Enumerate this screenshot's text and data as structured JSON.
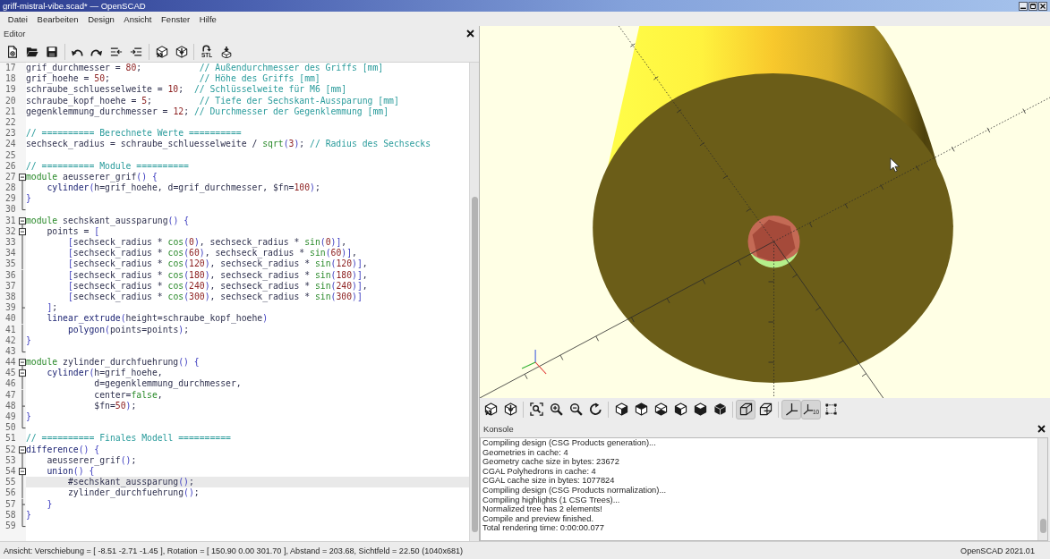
{
  "window": {
    "title": "griff-mistral-vibe.scad* — OpenSCAD"
  },
  "menu": [
    "Datei",
    "Bearbeiten",
    "Design",
    "Ansicht",
    "Fenster",
    "Hilfe"
  ],
  "editor": {
    "title": "Editor",
    "export_label": "STL",
    "lines": [
      {
        "number": "17",
        "kind": "plain",
        "selected": false,
        "tokens": [
          {
            "kind": "text",
            "text": "grif_durchmesser = "
          },
          {
            "kind": "number",
            "text": "80"
          },
          {
            "kind": "text",
            "text": ";           "
          },
          {
            "kind": "comment",
            "text": "// Außendurchmesser des Griffs [mm]"
          }
        ]
      },
      {
        "number": "18",
        "kind": "plain",
        "selected": false,
        "tokens": [
          {
            "kind": "text",
            "text": "grif_hoehe = "
          },
          {
            "kind": "number",
            "text": "50"
          },
          {
            "kind": "text",
            "text": ";                 "
          },
          {
            "kind": "comment",
            "text": "// Höhe des Griffs [mm]"
          }
        ]
      },
      {
        "number": "19",
        "kind": "plain",
        "selected": false,
        "tokens": [
          {
            "kind": "text",
            "text": "schraube_schluesselweite = "
          },
          {
            "kind": "number",
            "text": "10"
          },
          {
            "kind": "text",
            "text": ";  "
          },
          {
            "kind": "comment",
            "text": "// Schlüsselweite für M6 [mm]"
          }
        ]
      },
      {
        "number": "20",
        "kind": "plain",
        "selected": false,
        "tokens": [
          {
            "kind": "text",
            "text": "schraube_kopf_hoehe = "
          },
          {
            "kind": "number",
            "text": "5"
          },
          {
            "kind": "text",
            "text": ";         "
          },
          {
            "kind": "comment",
            "text": "// Tiefe der Sechskant-Aussparung [mm]"
          }
        ]
      },
      {
        "number": "21",
        "kind": "plain",
        "selected": false,
        "tokens": [
          {
            "kind": "text",
            "text": "gegenklemmung_durchmesser = "
          },
          {
            "kind": "number",
            "text": "12"
          },
          {
            "kind": "text",
            "text": "; "
          },
          {
            "kind": "comment",
            "text": "// Durchmesser der Gegenklemmung [mm]"
          }
        ]
      },
      {
        "number": "22",
        "kind": "plain",
        "selected": false
      },
      {
        "number": "23",
        "kind": "plain",
        "selected": false,
        "tokens": [
          {
            "kind": "comment",
            "text": "// ========== Berechnete Werte =========="
          }
        ]
      },
      {
        "number": "24",
        "kind": "plain",
        "selected": false,
        "tokens": [
          {
            "kind": "text",
            "text": "sechseck_radius = schraube_schluesselweite / "
          },
          {
            "kind": "keyword",
            "text": "sqrt"
          },
          {
            "kind": "bracket",
            "text": "("
          },
          {
            "kind": "number",
            "text": "3"
          },
          {
            "kind": "bracket",
            "text": ")"
          },
          {
            "kind": "text",
            "text": "; "
          },
          {
            "kind": "comment",
            "text": "// Radius des Sechsecks"
          }
        ]
      },
      {
        "number": "25",
        "kind": "plain",
        "selected": false
      },
      {
        "number": "26",
        "kind": "plain",
        "selected": false,
        "tokens": [
          {
            "kind": "comment",
            "text": "// ========== Module =========="
          }
        ]
      },
      {
        "number": "27",
        "kind": "start",
        "expanded": true,
        "selected": false,
        "tokens": [
          {
            "kind": "keyword",
            "text": "module"
          },
          {
            "kind": "text",
            "text": " aeusserer_grif"
          },
          {
            "kind": "bracket",
            "text": "() {"
          }
        ]
      },
      {
        "number": "28",
        "kind": "body",
        "selected": false,
        "tokens": [
          {
            "kind": "builtin",
            "text": "    cylinder"
          },
          {
            "kind": "bracket",
            "text": "("
          },
          {
            "kind": "text",
            "text": "h=grif_hoehe, d=grif_durchmesser, $fn="
          },
          {
            "kind": "number",
            "text": "100"
          },
          {
            "kind": "bracket",
            "text": ")"
          },
          {
            "kind": "text",
            "text": ";"
          }
        ]
      },
      {
        "number": "29",
        "kind": "body",
        "selected": false,
        "tokens": [
          {
            "kind": "bracket",
            "text": "}"
          }
        ]
      },
      {
        "number": "30",
        "kind": "end",
        "selected": false
      },
      {
        "number": "31",
        "kind": "start",
        "expanded": true,
        "selected": false,
        "tokens": [
          {
            "kind": "keyword",
            "text": "module"
          },
          {
            "kind": "text",
            "text": " sechskant_aussparung"
          },
          {
            "kind": "bracket",
            "text": "() {"
          }
        ]
      },
      {
        "number": "32",
        "kind": "start",
        "expanded": true,
        "selected": false,
        "tokens": [
          {
            "kind": "text",
            "text": "    points = "
          },
          {
            "kind": "bracket",
            "text": "["
          }
        ]
      },
      {
        "number": "33",
        "kind": "body",
        "selected": false,
        "tokens": [
          {
            "kind": "bracket",
            "text": "        ["
          },
          {
            "kind": "text",
            "text": "sechseck_radius * "
          },
          {
            "kind": "keyword",
            "text": "cos"
          },
          {
            "kind": "bracket",
            "text": "("
          },
          {
            "kind": "number",
            "text": "0"
          },
          {
            "kind": "bracket",
            "text": ")"
          },
          {
            "kind": "text",
            "text": ", sechseck_radius * "
          },
          {
            "kind": "keyword",
            "text": "sin"
          },
          {
            "kind": "bracket",
            "text": "("
          },
          {
            "kind": "number",
            "text": "0"
          },
          {
            "kind": "bracket",
            "text": ")]"
          },
          {
            "kind": "text",
            "text": ","
          }
        ]
      },
      {
        "number": "34",
        "kind": "body",
        "selected": false,
        "tokens": [
          {
            "kind": "bracket",
            "text": "        ["
          },
          {
            "kind": "text",
            "text": "sechseck_radius * "
          },
          {
            "kind": "keyword",
            "text": "cos"
          },
          {
            "kind": "bracket",
            "text": "("
          },
          {
            "kind": "number",
            "text": "60"
          },
          {
            "kind": "bracket",
            "text": ")"
          },
          {
            "kind": "text",
            "text": ", sechseck_radius * "
          },
          {
            "kind": "keyword",
            "text": "sin"
          },
          {
            "kind": "bracket",
            "text": "("
          },
          {
            "kind": "number",
            "text": "60"
          },
          {
            "kind": "bracket",
            "text": ")]"
          },
          {
            "kind": "text",
            "text": ","
          }
        ]
      },
      {
        "number": "35",
        "kind": "body",
        "selected": false,
        "tokens": [
          {
            "kind": "bracket",
            "text": "        ["
          },
          {
            "kind": "text",
            "text": "sechseck_radius * "
          },
          {
            "kind": "keyword",
            "text": "cos"
          },
          {
            "kind": "bracket",
            "text": "("
          },
          {
            "kind": "number",
            "text": "120"
          },
          {
            "kind": "bracket",
            "text": ")"
          },
          {
            "kind": "text",
            "text": ", sechseck_radius * "
          },
          {
            "kind": "keyword",
            "text": "sin"
          },
          {
            "kind": "bracket",
            "text": "("
          },
          {
            "kind": "number",
            "text": "120"
          },
          {
            "kind": "bracket",
            "text": ")]"
          },
          {
            "kind": "text",
            "text": ","
          }
        ]
      },
      {
        "number": "36",
        "kind": "body",
        "selected": false,
        "tokens": [
          {
            "kind": "bracket",
            "text": "        ["
          },
          {
            "kind": "text",
            "text": "sechseck_radius * "
          },
          {
            "kind": "keyword",
            "text": "cos"
          },
          {
            "kind": "bracket",
            "text": "("
          },
          {
            "kind": "number",
            "text": "180"
          },
          {
            "kind": "bracket",
            "text": ")"
          },
          {
            "kind": "text",
            "text": ", sechseck_radius * "
          },
          {
            "kind": "keyword",
            "text": "sin"
          },
          {
            "kind": "bracket",
            "text": "("
          },
          {
            "kind": "number",
            "text": "180"
          },
          {
            "kind": "bracket",
            "text": ")]"
          },
          {
            "kind": "text",
            "text": ","
          }
        ]
      },
      {
        "number": "37",
        "kind": "body",
        "selected": false,
        "tokens": [
          {
            "kind": "bracket",
            "text": "        ["
          },
          {
            "kind": "text",
            "text": "sechseck_radius * "
          },
          {
            "kind": "keyword",
            "text": "cos"
          },
          {
            "kind": "bracket",
            "text": "("
          },
          {
            "kind": "number",
            "text": "240"
          },
          {
            "kind": "bracket",
            "text": ")"
          },
          {
            "kind": "text",
            "text": ", sechseck_radius * "
          },
          {
            "kind": "keyword",
            "text": "sin"
          },
          {
            "kind": "bracket",
            "text": "("
          },
          {
            "kind": "number",
            "text": "240"
          },
          {
            "kind": "bracket",
            "text": ")]"
          },
          {
            "kind": "text",
            "text": ","
          }
        ]
      },
      {
        "number": "38",
        "kind": "body",
        "selected": false,
        "tokens": [
          {
            "kind": "bracket",
            "text": "        ["
          },
          {
            "kind": "text",
            "text": "sechseck_radius * "
          },
          {
            "kind": "keyword",
            "text": "cos"
          },
          {
            "kind": "bracket",
            "text": "("
          },
          {
            "kind": "number",
            "text": "300"
          },
          {
            "kind": "bracket",
            "text": ")"
          },
          {
            "kind": "text",
            "text": ", sechseck_radius * "
          },
          {
            "kind": "keyword",
            "text": "sin"
          },
          {
            "kind": "bracket",
            "text": "("
          },
          {
            "kind": "number",
            "text": "300"
          },
          {
            "kind": "bracket",
            "text": ")]"
          }
        ]
      },
      {
        "number": "39",
        "kind": "tick",
        "selected": false,
        "tokens": [
          {
            "kind": "bracket",
            "text": "    ]"
          },
          {
            "kind": "text",
            "text": ";"
          }
        ]
      },
      {
        "number": "40",
        "kind": "body",
        "selected": false,
        "tokens": [
          {
            "kind": "builtin",
            "text": "    linear_extrude"
          },
          {
            "kind": "bracket",
            "text": "("
          },
          {
            "kind": "text",
            "text": "height=schraube_kopf_hoehe"
          },
          {
            "kind": "bracket",
            "text": ")"
          }
        ]
      },
      {
        "number": "41",
        "kind": "body",
        "selected": false,
        "tokens": [
          {
            "kind": "builtin",
            "text": "        polygon"
          },
          {
            "kind": "bracket",
            "text": "("
          },
          {
            "kind": "text",
            "text": "points=points"
          },
          {
            "kind": "bracket",
            "text": ")"
          },
          {
            "kind": "text",
            "text": ";"
          }
        ]
      },
      {
        "number": "42",
        "kind": "body",
        "selected": false,
        "tokens": [
          {
            "kind": "bracket",
            "text": "}"
          }
        ]
      },
      {
        "number": "43",
        "kind": "end",
        "selected": false
      },
      {
        "number": "44",
        "kind": "start",
        "expanded": true,
        "selected": false,
        "tokens": [
          {
            "kind": "keyword",
            "text": "module"
          },
          {
            "kind": "text",
            "text": " zylinder_durchfuehrung"
          },
          {
            "kind": "bracket",
            "text": "() {"
          }
        ]
      },
      {
        "number": "45",
        "kind": "start",
        "expanded": true,
        "selected": false,
        "tokens": [
          {
            "kind": "builtin",
            "text": "    cylinder"
          },
          {
            "kind": "bracket",
            "text": "("
          },
          {
            "kind": "text",
            "text": "h=grif_hoehe,"
          }
        ]
      },
      {
        "number": "46",
        "kind": "body",
        "selected": false,
        "tokens": [
          {
            "kind": "text",
            "text": "             d=gegenklemmung_durchmesser,"
          }
        ]
      },
      {
        "number": "47",
        "kind": "body",
        "selected": false,
        "tokens": [
          {
            "kind": "text",
            "text": "             center="
          },
          {
            "kind": "keyword",
            "text": "false"
          },
          {
            "kind": "text",
            "text": ","
          }
        ]
      },
      {
        "number": "48",
        "kind": "tick",
        "selected": false,
        "tokens": [
          {
            "kind": "text",
            "text": "             $fn="
          },
          {
            "kind": "number",
            "text": "50"
          },
          {
            "kind": "bracket",
            "text": ")"
          },
          {
            "kind": "text",
            "text": ";"
          }
        ]
      },
      {
        "number": "49",
        "kind": "body",
        "selected": false,
        "tokens": [
          {
            "kind": "bracket",
            "text": "}"
          }
        ]
      },
      {
        "number": "50",
        "kind": "end",
        "selected": false
      },
      {
        "number": "51",
        "kind": "plain",
        "selected": false,
        "tokens": [
          {
            "kind": "comment",
            "text": "// ========== Finales Modell =========="
          }
        ]
      },
      {
        "number": "52",
        "kind": "start",
        "expanded": true,
        "selected": false,
        "tokens": [
          {
            "kind": "builtin",
            "text": "difference"
          },
          {
            "kind": "bracket",
            "text": "() {"
          }
        ]
      },
      {
        "number": "53",
        "kind": "body",
        "selected": false,
        "tokens": [
          {
            "kind": "text",
            "text": "    aeusserer_grif"
          },
          {
            "kind": "bracket",
            "text": "()"
          },
          {
            "kind": "text",
            "text": ";"
          }
        ]
      },
      {
        "number": "54",
        "kind": "start",
        "expanded": true,
        "selected": false,
        "tokens": [
          {
            "kind": "builtin",
            "text": "    union"
          },
          {
            "kind": "bracket",
            "text": "() {"
          }
        ]
      },
      {
        "number": "55",
        "kind": "body",
        "selected": true,
        "tokens": [
          {
            "kind": "text",
            "text": "        #sechskant_aussparung"
          },
          {
            "kind": "bracket",
            "text": "()"
          },
          {
            "kind": "text",
            "text": ";"
          }
        ]
      },
      {
        "number": "56",
        "kind": "body",
        "selected": false,
        "tokens": [
          {
            "kind": "text",
            "text": "        zylinder_durchfuehrung"
          },
          {
            "kind": "bracket",
            "text": "()"
          },
          {
            "kind": "text",
            "text": ";"
          }
        ]
      },
      {
        "number": "57",
        "kind": "tick",
        "selected": false,
        "tokens": [
          {
            "kind": "bracket",
            "text": "    }"
          }
        ]
      },
      {
        "number": "58",
        "kind": "body",
        "selected": false,
        "tokens": [
          {
            "kind": "bracket",
            "text": "}"
          }
        ]
      },
      {
        "number": "59",
        "kind": "end",
        "selected": false
      }
    ]
  },
  "viewer_toolbar": {
    "perspective_on": true,
    "orthogonal_on": false,
    "axes_on": true,
    "scale_markers_on": true,
    "scale_label": "10",
    "edges_on": false
  },
  "console": {
    "title": "Konsole",
    "lines": [
      "Compiling design (CSG Products generation)...",
      "Geometries in cache: 4",
      "Geometry cache size in bytes: 23672",
      "CGAL Polyhedrons in cache: 4",
      "CGAL cache size in bytes: 1077824",
      "Compiling design (CSG Products normalization)...",
      "Compiling highlights (1 CSG Trees)...",
      "Normalized tree has 2 elements!",
      "Compile and preview finished.",
      "Total rendering time: 0:00:00.077"
    ]
  },
  "status_bar": {
    "view_info": "Ansicht: Verschiebung = [ -8.51 -2.71 -1.45 ], Rotation = [ 150.90 0.00 301.70 ], Abstand = 203.68, Sichtfeld = 22.50 (1040x681)",
    "version": "OpenSCAD 2021.01"
  }
}
